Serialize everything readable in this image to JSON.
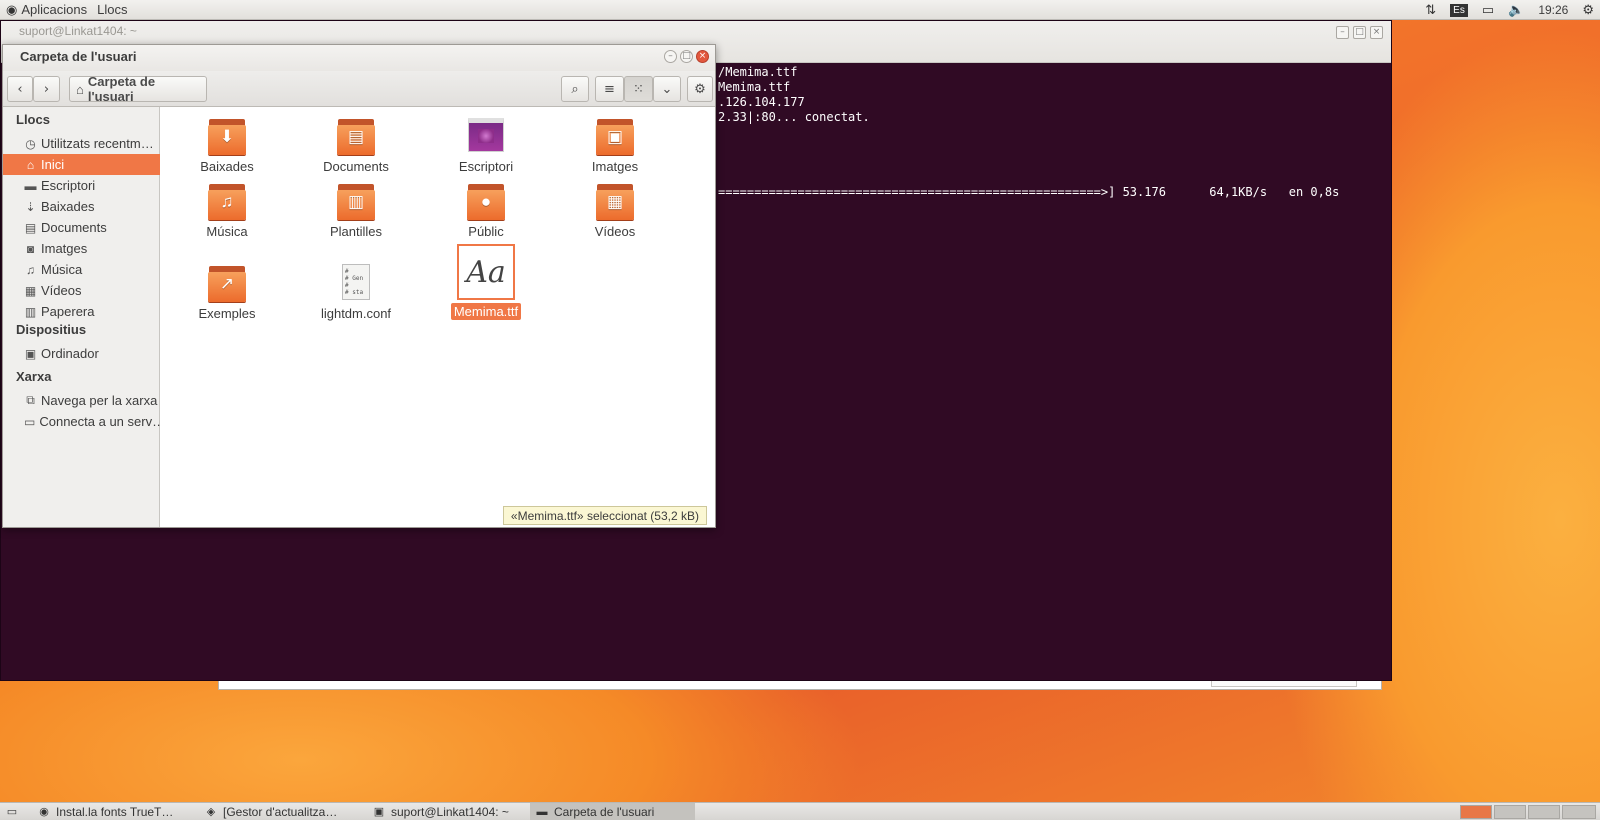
{
  "top_panel": {
    "menu_applications": "Aplicacions",
    "menu_places": "Llocs",
    "keyboard_layout": "Es",
    "clock": "19:26"
  },
  "terminal": {
    "title": "suport@Linkat1404: ~",
    "output_lines": [
      "/Memima.ttf",
      "Memima.ttf",
      ".126.104.177",
      "2.33|:80... conectat.",
      "",
      "",
      "",
      "",
      "=====================================================>] 53.176      64,1KB/s   en 0,8s"
    ]
  },
  "file_manager": {
    "title": "Carpeta de l'usuari",
    "path_button": "Carpeta de l'usuari",
    "sidebar": {
      "section_places": "Llocs",
      "section_devices": "Dispositius",
      "section_network": "Xarxa",
      "places": [
        {
          "label": "Utilitzats recentm…",
          "icon": "clock-icon"
        },
        {
          "label": "Inici",
          "icon": "home-icon",
          "active": true
        },
        {
          "label": "Escriptori",
          "icon": "folder-icon"
        },
        {
          "label": "Baixades",
          "icon": "download-icon"
        },
        {
          "label": "Documents",
          "icon": "document-icon"
        },
        {
          "label": "Imatges",
          "icon": "camera-icon"
        },
        {
          "label": "Música",
          "icon": "music-icon"
        },
        {
          "label": "Vídeos",
          "icon": "film-icon"
        },
        {
          "label": "Paperera",
          "icon": "trash-icon"
        }
      ],
      "devices": [
        {
          "label": "Ordinador",
          "icon": "drive-icon"
        }
      ],
      "network": [
        {
          "label": "Navega per la xarxa",
          "icon": "network-icon"
        },
        {
          "label": "Connecta a un serv…",
          "icon": "server-icon"
        }
      ]
    },
    "files": [
      {
        "label": "Baixades",
        "type": "folder",
        "glyph": "⬇"
      },
      {
        "label": "Documents",
        "type": "folder",
        "glyph": "▤"
      },
      {
        "label": "Escriptori",
        "type": "desktop"
      },
      {
        "label": "Imatges",
        "type": "folder",
        "glyph": "▣"
      },
      {
        "label": "Música",
        "type": "folder",
        "glyph": "♫"
      },
      {
        "label": "Plantilles",
        "type": "folder",
        "glyph": "▥"
      },
      {
        "label": "Públic",
        "type": "folder",
        "glyph": "●"
      },
      {
        "label": "Vídeos",
        "type": "folder",
        "glyph": "▦"
      },
      {
        "label": "Exemples",
        "type": "folder",
        "glyph": "↗"
      },
      {
        "label": "lightdm.conf",
        "type": "text",
        "preview": "#\n# Gen\n#\n# sta"
      },
      {
        "label": "Memima.ttf",
        "type": "font",
        "preview": "Aa",
        "selected": true
      }
    ],
    "status": "«Memima.ttf» seleccionat  (53,2 kB)"
  },
  "taskbar": {
    "tasks": [
      {
        "label": "Instal.la fonts TrueT…",
        "icon": "firefox-icon"
      },
      {
        "label": "[Gestor d'actualitza…",
        "icon": "update-manager-icon"
      },
      {
        "label": "suport@Linkat1404: ~",
        "icon": "terminal-icon"
      },
      {
        "label": "Carpeta de l'usuari",
        "icon": "folder-icon",
        "active": true
      }
    ]
  },
  "colors": {
    "accent": "#f07746",
    "terminal_bg": "#300a24",
    "panel_bg": "#e9e8e6"
  }
}
